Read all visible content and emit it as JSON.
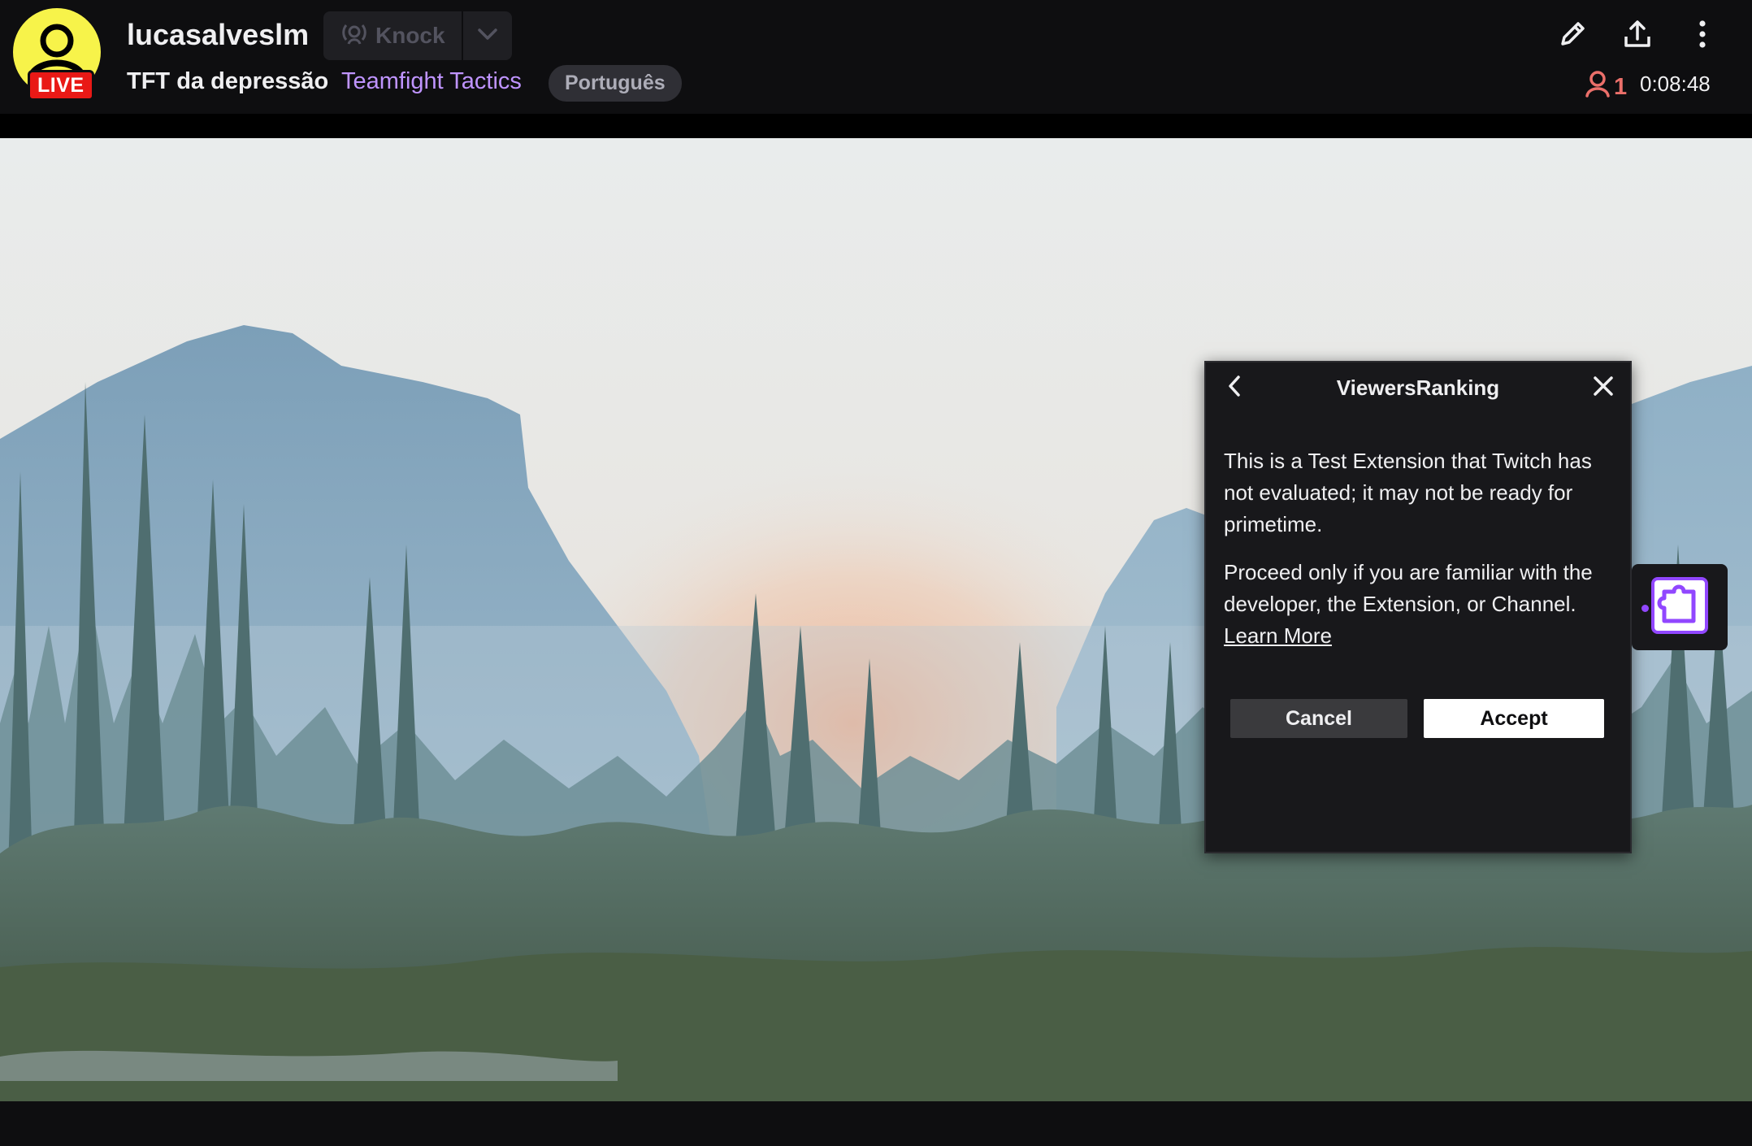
{
  "header": {
    "channel_name": "lucasalveslm",
    "live_badge": "LIVE",
    "knock_label": "Knock",
    "stream_title": "TFT da depressão",
    "game": "Teamfight Tactics",
    "language_tag": "Português",
    "viewer_count": "1",
    "uptime": "0:08:48",
    "icons": [
      "edit-icon",
      "share-icon",
      "more-icon",
      "viewer-icon",
      "knock-icon",
      "chevron-down-icon"
    ],
    "colors": {
      "live": "#e91916",
      "game_link": "#bf94ff",
      "viewer": "#eb6f6a",
      "avatar": "#f7f34a"
    }
  },
  "extension_dialog": {
    "title": "ViewersRanking",
    "paragraph_1": "This is a Test Extension that Twitch has not evaluated; it may not be ready for primetime.",
    "paragraph_2": "Proceed only if you are familiar with the developer, the Extension, or Channel.",
    "learn_more": "Learn More",
    "cancel_label": "Cancel",
    "accept_label": "Accept"
  },
  "extension_launcher": {
    "icon": "puzzle-icon",
    "accent": "#9147ff"
  }
}
